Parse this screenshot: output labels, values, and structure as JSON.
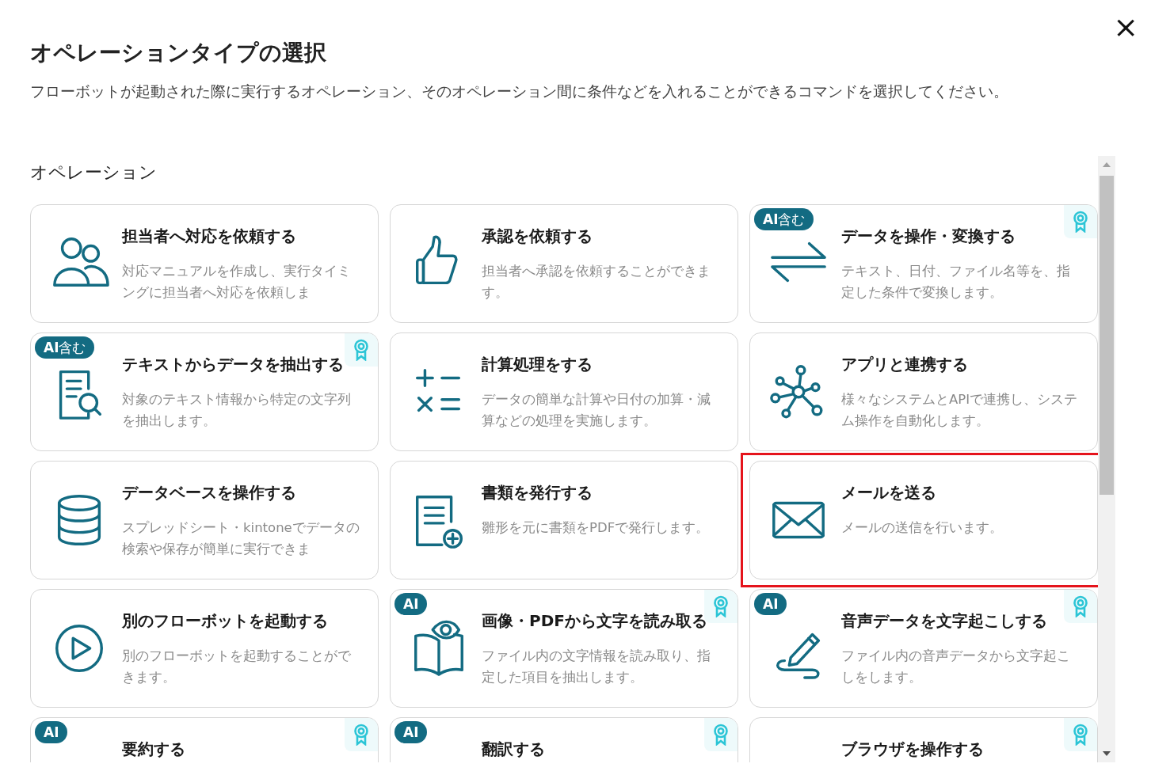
{
  "dialog": {
    "title": "オペレーションタイプの選択",
    "description": "フローボットが起動された際に実行するオペレーション、そのオペレーション間に条件などを入れることができるコマンドを選択してください。",
    "close": "×"
  },
  "section": {
    "heading": "オペレーション"
  },
  "cards": [
    {
      "title": "担当者へ対応を依頼する",
      "description": "対応マニュアルを作成し、実行タイミングに担当者へ対応を依頼しま",
      "award": false,
      "highlighted": false
    },
    {
      "title": "承認を依頼する",
      "description": "担当者へ承認を依頼することができます。",
      "award": false,
      "highlighted": false
    },
    {
      "badge": "**AI**含む",
      "title": "データを操作・変換する",
      "description": "テキスト、日付、ファイル名等を、指定した条件で変換します。",
      "award": true,
      "highlighted": false
    },
    {
      "badge": "**AI**含む",
      "title": "テキストからデータを抽出する",
      "description": "対象のテキスト情報から特定の文字列を抽出します。",
      "award": true,
      "highlighted": false
    },
    {
      "title": "計算処理をする",
      "description": "データの簡単な計算や日付の加算・減算などの処理を実施します。",
      "award": false,
      "highlighted": false
    },
    {
      "title": "アプリと連携する",
      "description": "様々なシステムとAPIで連携し、システム操作を自動化します。",
      "award": false,
      "highlighted": false
    },
    {
      "title": "データベースを操作する",
      "description": "スプレッドシート・kintoneでデータの検索や保存が簡単に実行できま",
      "award": false,
      "highlighted": false
    },
    {
      "title": "書類を発行する",
      "description": "雛形を元に書類をPDFで発行します。",
      "award": false,
      "highlighted": false
    },
    {
      "title": "メールを送る",
      "description": "メールの送信を行います。",
      "award": false,
      "highlighted": true
    },
    {
      "title": "別のフローボットを起動する",
      "description": "別のフローボットを起動することができます。",
      "award": false,
      "highlighted": false
    },
    {
      "badge": "**AI**",
      "title": "画像・PDFから文字を読み取る",
      "description": "ファイル内の文字情報を読み取り、指定した項目を抽出します。",
      "award": true,
      "highlighted": false
    },
    {
      "badge": "**AI**",
      "title": "音声データを文字起こしする",
      "description": "ファイル内の音声データから文字起こしをします。",
      "award": true,
      "highlighted": false
    },
    {
      "badge": "**AI**",
      "title": "要約する",
      "award": true,
      "highlighted": false
    },
    {
      "badge": "**AI**",
      "title": "翻訳する",
      "award": true,
      "highlighted": false
    },
    {
      "title": "ブラウザを操作する",
      "award": true,
      "highlighted": false
    }
  ]
}
